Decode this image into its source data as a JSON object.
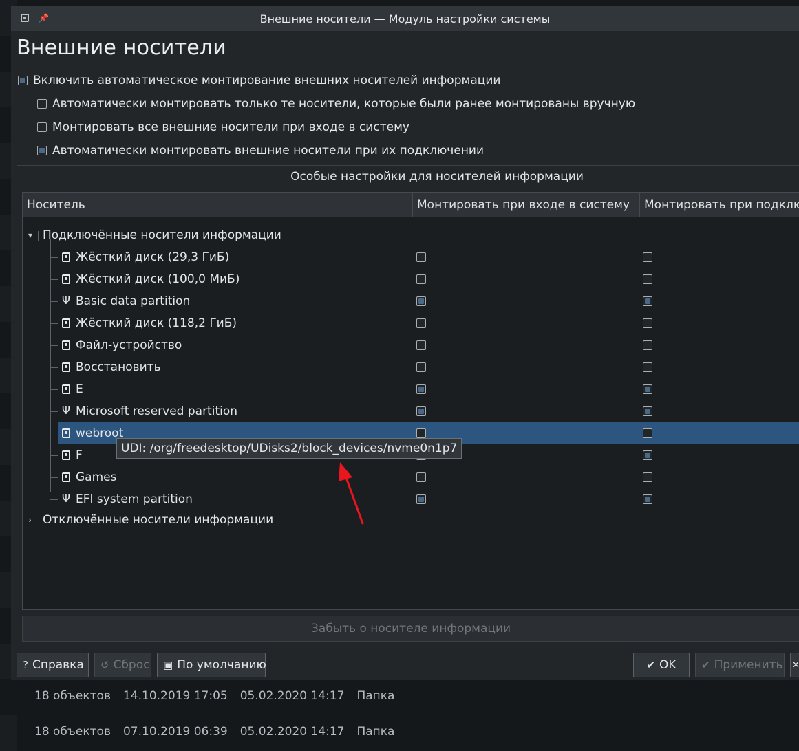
{
  "window": {
    "title": "Внешние носители — Модуль настройки системы"
  },
  "page": {
    "title": "Внешние носители"
  },
  "options": {
    "auto_mount": {
      "label": "Включить автоматическое монтирование внешних носителей информации",
      "checked": true
    },
    "only_manual": {
      "label": "Автоматически монтировать только те носители, которые были ранее монтированы вручную",
      "checked": false
    },
    "on_login": {
      "label": "Монтировать все внешние носители при входе в систему",
      "checked": false
    },
    "on_attach": {
      "label": "Автоматически монтировать внешние носители при их подключении",
      "checked": true
    }
  },
  "device_settings": {
    "group_title": "Особые настройки для носителей информации",
    "columns": [
      "Носитель",
      "Монтировать при входе в систему",
      "Монтировать при подключе"
    ],
    "connected_group": "Подключённые носители информации",
    "disconnected_group": "Отключённые носители информации",
    "devices": [
      {
        "name": "Жёсткий диск (29,3 ГиБ)",
        "icon": "hard-disk-icon",
        "login": false,
        "attach": false
      },
      {
        "name": "Жёсткий диск (100,0 МиБ)",
        "icon": "hard-disk-icon",
        "login": false,
        "attach": false
      },
      {
        "name": "Basic data partition",
        "icon": "usb-icon",
        "login": true,
        "attach": true
      },
      {
        "name": "Жёсткий диск (118,2 ГиБ)",
        "icon": "encrypted-disk-icon",
        "login": false,
        "attach": false
      },
      {
        "name": "Файл-устройство",
        "icon": "hard-disk-icon",
        "login": false,
        "attach": false
      },
      {
        "name": "Восстановить",
        "icon": "hard-disk-icon",
        "login": false,
        "attach": false
      },
      {
        "name": "E",
        "icon": "hard-disk-icon",
        "login": true,
        "attach": true
      },
      {
        "name": "Microsoft reserved partition",
        "icon": "usb-icon",
        "login": true,
        "attach": true
      },
      {
        "name": "webroot",
        "icon": "hard-disk-icon",
        "login": false,
        "attach": false,
        "selected": true
      },
      {
        "name": "F",
        "icon": "hard-disk-icon",
        "login": true,
        "attach": true
      },
      {
        "name": "Games",
        "icon": "hard-disk-icon",
        "login": false,
        "attach": false
      },
      {
        "name": "EFI system partition",
        "icon": "usb-icon",
        "login": true,
        "attach": true
      }
    ],
    "tooltip": "UDI: /org/freedesktop/UDisks2/block_devices/nvme0n1p7",
    "forget_button": "Забыть о носителе информации"
  },
  "buttons": {
    "help": "Справка",
    "reset": "Сброс",
    "defaults": "По умолчанию",
    "ok": "OK",
    "apply": "Применить"
  },
  "colors": {
    "selection": "#2c5680",
    "arrow": "#e8161e"
  },
  "background_rows": [
    {
      "count": "18 объектов",
      "created": "14.10.2019 17:05",
      "modified": "05.02.2020 14:17",
      "type": "Папка"
    },
    {
      "count": "18 объектов",
      "created": "07.10.2019 06:39",
      "modified": "05.02.2020 14:17",
      "type": "Папка"
    }
  ]
}
